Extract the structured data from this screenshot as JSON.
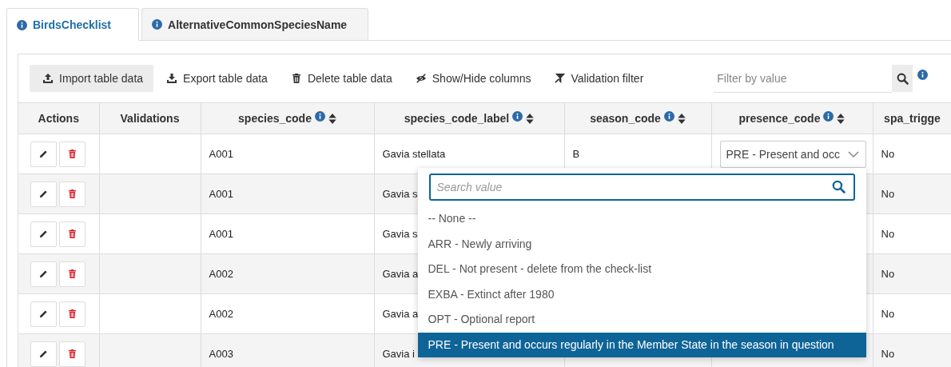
{
  "tabs": [
    {
      "label": "BirdsChecklist",
      "selected": true
    },
    {
      "label": "AlternativeCommonSpeciesName",
      "selected": false
    }
  ],
  "toolbar": [
    {
      "label": "Import table data",
      "kind": "upload",
      "active": true
    },
    {
      "label": "Export table data",
      "kind": "download",
      "active": false
    },
    {
      "label": "Delete table data",
      "kind": "trash",
      "active": false
    },
    {
      "label": "Show/Hide columns",
      "kind": "eye",
      "active": false
    },
    {
      "label": "Validation filter",
      "kind": "filter",
      "active": false
    }
  ],
  "filter": {
    "placeholder": "Filter by value"
  },
  "columns": [
    {
      "label": "Actions",
      "info": false,
      "sortable": false
    },
    {
      "label": "Validations",
      "info": false,
      "sortable": false
    },
    {
      "label": "species_code",
      "info": true,
      "sortable": true
    },
    {
      "label": "species_code_label",
      "info": true,
      "sortable": true
    },
    {
      "label": "season_code",
      "info": true,
      "sortable": true
    },
    {
      "label": "presence_code",
      "info": true,
      "sortable": true
    },
    {
      "label": "spa_trigge",
      "info": false,
      "sortable": false
    }
  ],
  "rows": [
    {
      "species_code": "A001",
      "species_code_label": "Gavia stellata",
      "season_code": "B",
      "presence_code": "PRE - Present and occ",
      "spa_trigger": "No"
    },
    {
      "species_code": "A001",
      "species_code_label": "Gavia s",
      "spa_trigger": "No"
    },
    {
      "species_code": "A001",
      "species_code_label": "Gavia s",
      "spa_trigger": "No"
    },
    {
      "species_code": "A002",
      "species_code_label": "Gavia a",
      "spa_trigger": "No"
    },
    {
      "species_code": "A002",
      "species_code_label": "Gavia a",
      "spa_trigger": "No"
    },
    {
      "species_code": "A003",
      "species_code_label": "Gavia i",
      "spa_trigger": "No"
    }
  ],
  "dropdown": {
    "search_placeholder": "Search value",
    "options": [
      {
        "label": "-- None --",
        "selected": false
      },
      {
        "label": "ARR - Newly arriving",
        "selected": false
      },
      {
        "label": "DEL - Not present - delete from the check-list",
        "selected": false
      },
      {
        "label": "EXBA - Extinct after 1980",
        "selected": false
      },
      {
        "label": "OPT - Optional report",
        "selected": false
      },
      {
        "label": "PRE - Present and occurs regularly in the Member State in the season in question",
        "selected": true
      }
    ]
  }
}
